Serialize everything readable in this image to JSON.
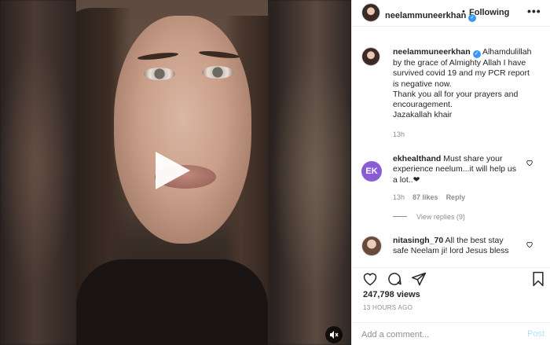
{
  "post": {
    "author": "neelammuneerkhan",
    "follow_status": "Following",
    "header_separator": "•",
    "more_glyph": "•••"
  },
  "caption": {
    "username": "neelammuneerkhan",
    "lines": [
      "Alhamdulillah",
      "by the grace of Almighty Allah I have",
      "survived covid 19 and my PCR report",
      "is negative now.",
      "Thank you all for your prayers and",
      "encouragement.",
      "Jazakallah khair"
    ],
    "time": "13h"
  },
  "comments": [
    {
      "avatar_initials": "EK",
      "username": "ekhealthand",
      "lines": [
        "Must share your",
        "experience neelum...it will help us",
        "a lot..❤"
      ],
      "time": "13h",
      "likes": "87 likes",
      "reply_label": "Reply",
      "view_replies": "View replies (9)"
    },
    {
      "username": "nitasingh_70",
      "lines": [
        "All the best stay",
        "safe Neelam ji! lord Jesus bless"
      ]
    }
  ],
  "actions": {
    "views": "247,798 views",
    "time_ago": "13 HOURS AGO"
  },
  "add_comment": {
    "placeholder": "Add a comment...",
    "post_label": "Post"
  },
  "icons": {
    "like": "heart-icon",
    "comment": "comment-icon",
    "share": "share-icon",
    "save": "bookmark-icon",
    "play": "play-icon",
    "mute": "speaker-muted-icon",
    "verified": "verified-badge-icon"
  },
  "colors": {
    "verified_blue": "#3897f0",
    "post_button_disabled": "#b2dffc",
    "secondary_text": "#8e8e8e",
    "ek_avatar": "#8a5cd6"
  }
}
